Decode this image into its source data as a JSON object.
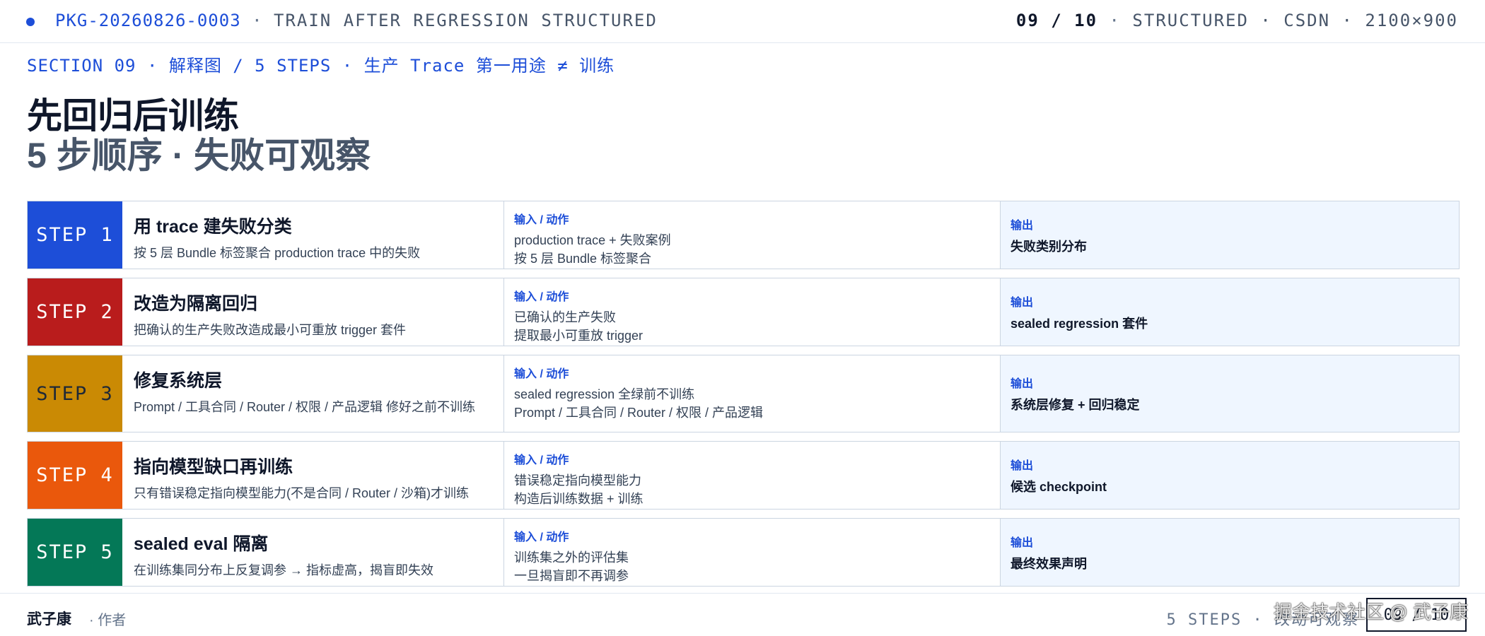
{
  "header": {
    "package_id": "PKG-20260826-0003",
    "title": "TRAIN AFTER REGRESSION STRUCTURED",
    "page": "09 / 10",
    "meta": "STRUCTURED · CSDN · 2100×900"
  },
  "section_label": "SECTION 09 · 解释图 / 5 STEPS · 生产 Trace 第一用途 ≠ 训练",
  "headline": {
    "line1": "先回归后训练",
    "line2": "5 步顺序 · 失败可观察"
  },
  "labels": {
    "input_action": "输入 / 动作",
    "output": "输出"
  },
  "steps": [
    {
      "badge": "STEP 1",
      "color": "#1d4ed8",
      "title": "用 trace 建失败分类",
      "desc": "按 5 层 Bundle 标签聚合 production trace 中的失败",
      "inputs": [
        "production trace + 失败案例",
        "按 5 层 Bundle 标签聚合"
      ],
      "output": "失败类别分布"
    },
    {
      "badge": "STEP 2",
      "color": "#b91c1c",
      "title": "改造为隔离回归",
      "desc": "把确认的生产失败改造成最小可重放 trigger 套件",
      "inputs": [
        "已确认的生产失败",
        "提取最小可重放 trigger"
      ],
      "output": "sealed regression 套件"
    },
    {
      "badge": "STEP 3",
      "color": "#ca8a04",
      "title": "修复系统层",
      "desc": "Prompt / 工具合同 / Router / 权限 / 产品逻辑 修好之前不训练",
      "inputs": [
        "sealed regression 全绿前不训练",
        "Prompt / 工具合同 / Router / 权限 / 产品逻辑"
      ],
      "output": "系统层修复 + 回归稳定"
    },
    {
      "badge": "STEP 4",
      "color": "#ea580c",
      "title": "指向模型缺口再训练",
      "desc": "只有错误稳定指向模型能力(不是合同 / Router / 沙箱)才训练",
      "inputs": [
        "错误稳定指向模型能力",
        "构造后训练数据 + 训练"
      ],
      "output": "候选 checkpoint"
    },
    {
      "badge": "STEP 5",
      "color": "#047857",
      "title": "sealed eval 隔离",
      "desc": "在训练集同分布上反复调参 → 指标虚高，揭盲即失效",
      "inputs": [
        "训练集之外的评估集",
        "一旦揭盲即不再调参"
      ],
      "output": "最终效果声明"
    }
  ],
  "footer": {
    "author": "武子康",
    "role": "· 作者",
    "right_text": "5 STEPS · 改动可观察",
    "page": "09 / 10",
    "watermark": "掘金技术社区 @ 武子康"
  }
}
